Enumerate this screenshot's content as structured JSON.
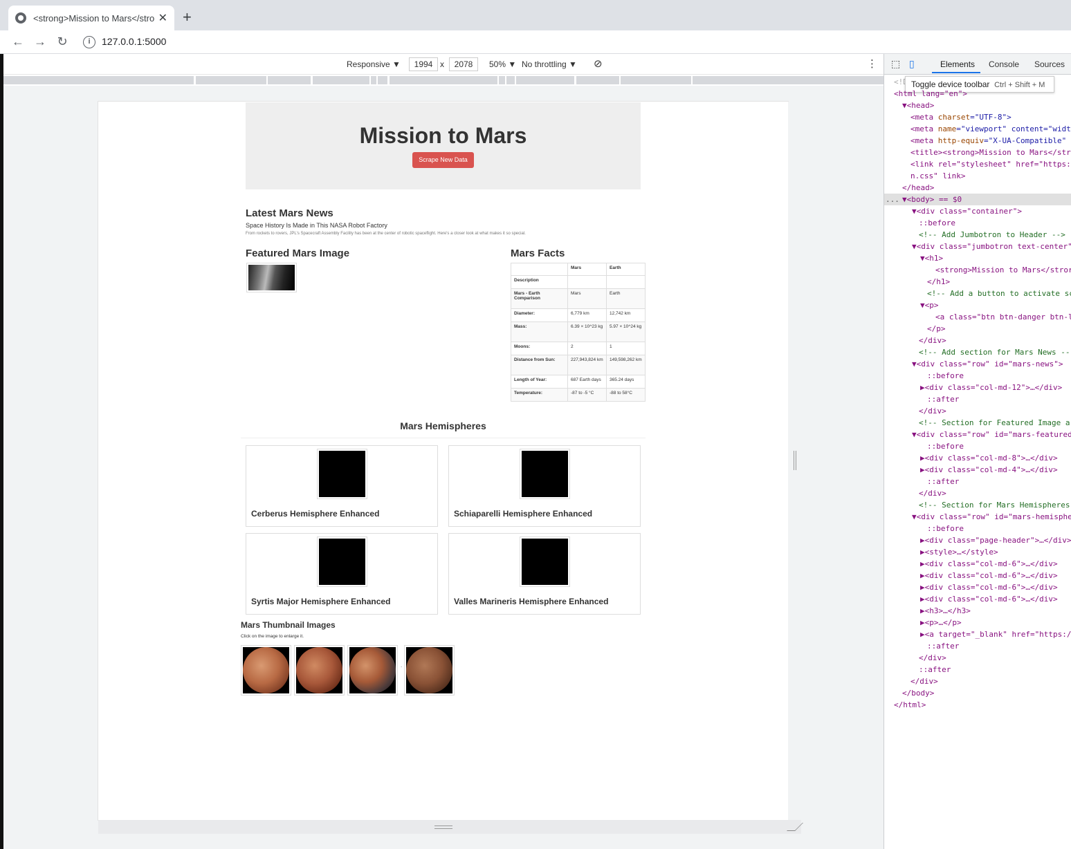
{
  "browser": {
    "tab_title": "<strong>Mission to Mars</strong>",
    "tab_close": "✕",
    "new_tab": "+",
    "back": "←",
    "forward": "→",
    "reload": "↻",
    "info": "i",
    "url": "127.0.0.1:5000"
  },
  "emulation": {
    "device": "Responsive ▼",
    "width": "1994",
    "times": "x",
    "height": "2078",
    "zoom": "50% ▼",
    "throttle": "No throttling ▼",
    "rotate_icon": "⊘",
    "more": "⋮"
  },
  "site": {
    "title": "Mission to Mars",
    "scrape_button": "Scrape New Data",
    "news_heading": "Latest Mars News",
    "news_title": "Space History Is Made in This NASA Robot Factory",
    "news_paragraph": "From rockets to rovers, JPL's Spacecraft Assembly Facility has been at the center of robotic spaceflight. Here's a closer look at what makes it so special.",
    "featured_heading": "Featured Mars Image",
    "facts_heading": "Mars Facts",
    "facts_table": {
      "headers": [
        "",
        "Mars",
        "Earth"
      ],
      "rows": [
        [
          "Description",
          "",
          ""
        ],
        [
          "Mars - Earth Comparison",
          "Mars",
          "Earth"
        ],
        [
          "Diameter:",
          "6,779 km",
          "12,742 km"
        ],
        [
          "Mass:",
          "6.39 × 10^23 kg",
          "5.97 × 10^24 kg"
        ],
        [
          "Moons:",
          "2",
          "1"
        ],
        [
          "Distance from Sun:",
          "227,943,824 km",
          "149,598,262 km"
        ],
        [
          "Length of Year:",
          "687 Earth days",
          "365.24 days"
        ],
        [
          "Temperature:",
          "-87 to -5 °C",
          "-88 to 58°C"
        ]
      ]
    },
    "hemispheres_heading": "Mars Hemispheres",
    "hemispheres": [
      {
        "title": "Cerberus Hemisphere Enhanced"
      },
      {
        "title": "Schiaparelli Hemisphere Enhanced"
      },
      {
        "title": "Syrtis Major Hemisphere Enhanced"
      },
      {
        "title": "Valles Marineris Hemisphere Enhanced"
      }
    ],
    "thumb_heading": "Mars Thumbnail Images",
    "thumb_note": "Click on the image to enlarge it.",
    "thumb_sep": "."
  },
  "devtools": {
    "tabs": [
      "Elements",
      "Console",
      "Sources"
    ],
    "tooltip_label": "Toggle device toolbar",
    "tooltip_shortcut": "Ctrl + Shift + M",
    "top_fragment": "<!D",
    "lines": [
      {
        "tag": "<html lang=\"en\">"
      },
      {
        "tag": "▼<head>"
      },
      {
        "a": "<meta ",
        "b": "charset",
        "c": "=\"UTF-8\">"
      },
      {
        "a": "<meta ",
        "b": "name",
        "c": "=\"viewport\" content=\"widt"
      },
      {
        "a": "<meta ",
        "b": "http-equiv",
        "c": "=\"X-UA-Compatible\""
      },
      {
        "tag": "<title><strong>Mission to Mars</str"
      },
      {
        "tag": "<link rel=\"stylesheet\" href=\"https:"
      },
      {
        "tag": "n.css\" link>"
      },
      {
        "tag": "</head>"
      },
      {
        "tag": "▼<body> == $0"
      },
      {
        "tag": "▼<div class=\"container\">"
      },
      {
        "tag": "::before"
      },
      {
        "tag": "<!-- Add Jumbotron to Header -->"
      },
      {
        "tag": "▼<div class=\"jumbotron text-center\""
      },
      {
        "tag": "▼<h1>"
      },
      {
        "tag": "<strong>Mission to Mars</stror"
      },
      {
        "tag": "</h1>"
      },
      {
        "tag": "<!-- Add a button to activate sc"
      },
      {
        "tag": "▼<p>"
      },
      {
        "tag": "<a class=\"btn btn-danger btn-l"
      },
      {
        "tag": "</p>"
      },
      {
        "tag": "</div>"
      },
      {
        "tag": "<!-- Add section for Mars News --"
      },
      {
        "tag": "▼<div class=\"row\" id=\"mars-news\">"
      },
      {
        "tag": "::before"
      },
      {
        "tag": "▶<div class=\"col-md-12\">…</div>"
      },
      {
        "tag": "::after"
      },
      {
        "tag": "</div>"
      },
      {
        "tag": "<!-- Section for Featured Image ar"
      },
      {
        "tag": "▼<div class=\"row\" id=\"mars-featured"
      },
      {
        "tag": "::before"
      },
      {
        "tag": "▶<div class=\"col-md-8\">…</div>"
      },
      {
        "tag": "▶<div class=\"col-md-4\">…</div>"
      },
      {
        "tag": "::after"
      },
      {
        "tag": "</div>"
      },
      {
        "tag": "<!-- Section for Mars Hemispheres"
      },
      {
        "tag": "▼<div class=\"row\" id=\"mars-hemisphe"
      },
      {
        "tag": "::before"
      },
      {
        "tag": "▶<div class=\"page-header\">…</div>"
      },
      {
        "tag": "▶<style>…</style>"
      },
      {
        "tag": "▶<div class=\"col-md-6\">…</div>"
      },
      {
        "tag": "▶<div class=\"col-md-6\">…</div>"
      },
      {
        "tag": "▶<div class=\"col-md-6\">…</div>"
      },
      {
        "tag": "▶<div class=\"col-md-6\">…</div>"
      },
      {
        "tag": "▶<h3>…</h3>"
      },
      {
        "tag": "▶<p>…</p>"
      },
      {
        "tag": "▶<a target=\"_blank\" href=\"https:/"
      },
      {
        "tag": "::after"
      },
      {
        "tag": "</div>"
      },
      {
        "tag": "::after"
      },
      {
        "tag": "</div>"
      },
      {
        "tag": "</body>"
      },
      {
        "tag": "</html>"
      }
    ],
    "dots": "..."
  }
}
